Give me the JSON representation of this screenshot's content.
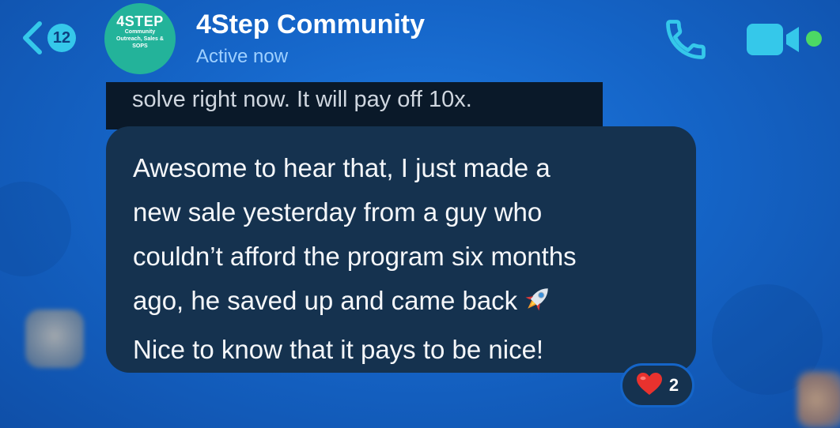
{
  "header": {
    "back_icon": "chevron-left-icon",
    "unread_count": "12",
    "avatar": {
      "brand": "4STEP",
      "lines": [
        "Community",
        "Outreach, Sales &",
        "SOPS"
      ],
      "color": "#23b39a"
    },
    "title": "4Step Community",
    "status": "Active now",
    "call_icon": "phone-icon",
    "video_icon": "video-camera-icon",
    "active_color": "#4cd964"
  },
  "quoted_message": {
    "text": "solve right now. It will pay off 10x."
  },
  "message": {
    "lines": [
      "Awesome to hear that, I just made a",
      "new sale yesterday from a guy who",
      "couldn’t afford the program six months",
      "ago, he saved up and came back",
      "Nice to know that it pays to be nice!"
    ],
    "emoji": "rocket-emoji",
    "bubble_color": "#15324f"
  },
  "reaction": {
    "emoji": "heart-emoji",
    "count": "2"
  },
  "colors": {
    "background": "#1565c8",
    "accent": "#35c8ea"
  }
}
